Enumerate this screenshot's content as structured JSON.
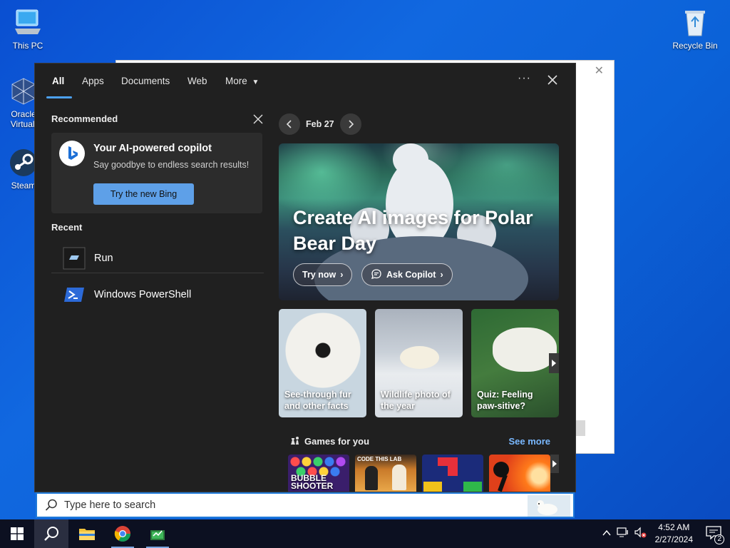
{
  "desktop": {
    "icons": [
      {
        "label": "This PC",
        "icon": "computer-icon"
      },
      {
        "label": "Oracle\nVirtualB",
        "icon": "virtualbox-icon"
      },
      {
        "label": "Steam",
        "icon": "steam-icon"
      },
      {
        "label": "Recycle Bin",
        "icon": "recycle-bin-icon"
      }
    ]
  },
  "search_panel": {
    "tabs": [
      "All",
      "Apps",
      "Documents",
      "Web",
      "More"
    ],
    "active_tab": "All",
    "recommended": {
      "title": "Recommended",
      "card_title": "Your AI-powered copilot",
      "card_subtitle": "Say goodbye to endless search results!",
      "button": "Try the new Bing"
    },
    "recent": {
      "title": "Recent",
      "items": [
        {
          "label": "Run",
          "icon": "run-icon"
        },
        {
          "label": "Windows PowerShell",
          "icon": "powershell-icon"
        }
      ]
    },
    "highlights": {
      "date": "Feb 27",
      "hero_title": "Create AI images for Polar Bear Day",
      "try_now": "Try now",
      "ask_copilot": "Ask Copilot",
      "cards": [
        {
          "caption": "See-through fur and other facts"
        },
        {
          "caption": "Wildlife photo of the year"
        },
        {
          "caption": "Quiz: Feeling paw-sitive?"
        }
      ],
      "games_title": "Games for you",
      "see_more": "See more",
      "games": [
        "BUBBLE SHOOTER",
        "CODETHISLAB",
        "Blocks",
        "Stickman"
      ]
    }
  },
  "searchbox": {
    "placeholder": "Type here to search"
  },
  "taskbar": {
    "time": "4:52 AM",
    "date": "2/27/2024",
    "notification_count": "2",
    "apps": [
      "start-icon",
      "search-icon",
      "file-explorer-icon",
      "chrome-icon",
      "app-icon"
    ]
  },
  "colors": {
    "accent": "#4ca1f0",
    "panel_bg": "#202020",
    "taskbar_bg": "#0c1021"
  }
}
